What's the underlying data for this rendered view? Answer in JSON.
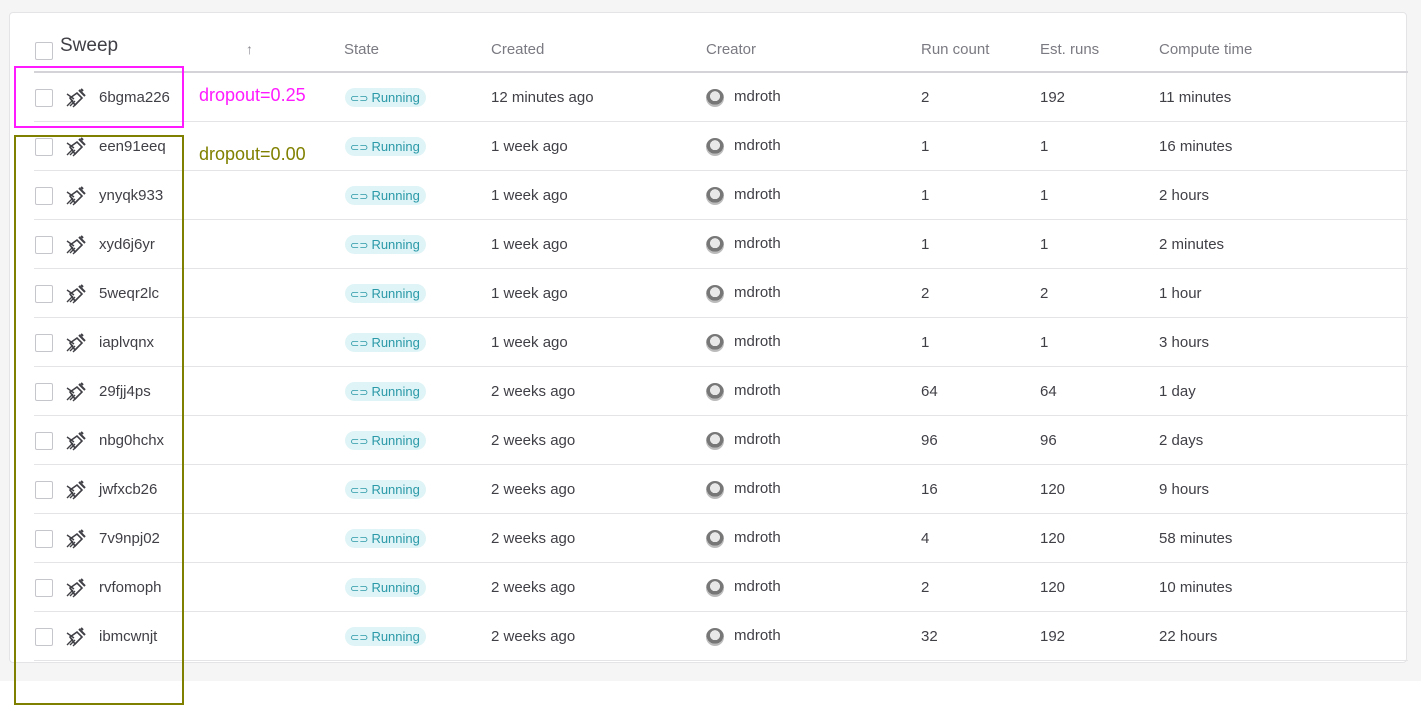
{
  "header": {
    "sweep": "Sweep",
    "state": "State",
    "created": "Created",
    "creator": "Creator",
    "run_count": "Run count",
    "est_runs": "Est. runs",
    "compute_time": "Compute time",
    "sort_icon": "arrow-up"
  },
  "annotations": {
    "magenta_label": "dropout=0.25",
    "olive_label": "dropout=0.00",
    "magenta_color": "#ff1aff",
    "olive_color": "#808000"
  },
  "colors": {
    "badge_bg": "#dff4f6",
    "badge_text": "#2b99a8"
  },
  "rows": [
    {
      "name": "6bgma226",
      "state": "Running",
      "created": "12 minutes ago",
      "creator": "mdroth",
      "run_count": "2",
      "est_runs": "192",
      "compute_time": "11 minutes"
    },
    {
      "name": "een91eeq",
      "state": "Running",
      "created": "1 week ago",
      "creator": "mdroth",
      "run_count": "1",
      "est_runs": "1",
      "compute_time": "16 minutes"
    },
    {
      "name": "ynyqk933",
      "state": "Running",
      "created": "1 week ago",
      "creator": "mdroth",
      "run_count": "1",
      "est_runs": "1",
      "compute_time": "2 hours"
    },
    {
      "name": "xyd6j6yr",
      "state": "Running",
      "created": "1 week ago",
      "creator": "mdroth",
      "run_count": "1",
      "est_runs": "1",
      "compute_time": "2 minutes"
    },
    {
      "name": "5weqr2lc",
      "state": "Running",
      "created": "1 week ago",
      "creator": "mdroth",
      "run_count": "2",
      "est_runs": "2",
      "compute_time": "1 hour"
    },
    {
      "name": "iaplvqnx",
      "state": "Running",
      "created": "1 week ago",
      "creator": "mdroth",
      "run_count": "1",
      "est_runs": "1",
      "compute_time": "3 hours"
    },
    {
      "name": "29fjj4ps",
      "state": "Running",
      "created": "2 weeks ago",
      "creator": "mdroth",
      "run_count": "64",
      "est_runs": "64",
      "compute_time": "1 day"
    },
    {
      "name": "nbg0hchx",
      "state": "Running",
      "created": "2 weeks ago",
      "creator": "mdroth",
      "run_count": "96",
      "est_runs": "96",
      "compute_time": "2 days"
    },
    {
      "name": "jwfxcb26",
      "state": "Running",
      "created": "2 weeks ago",
      "creator": "mdroth",
      "run_count": "16",
      "est_runs": "120",
      "compute_time": "9 hours"
    },
    {
      "name": "7v9npj02",
      "state": "Running",
      "created": "2 weeks ago",
      "creator": "mdroth",
      "run_count": "4",
      "est_runs": "120",
      "compute_time": "58 minutes"
    },
    {
      "name": "rvfomoph",
      "state": "Running",
      "created": "2 weeks ago",
      "creator": "mdroth",
      "run_count": "2",
      "est_runs": "120",
      "compute_time": "10 minutes"
    },
    {
      "name": "ibmcwnjt",
      "state": "Running",
      "created": "2 weeks ago",
      "creator": "mdroth",
      "run_count": "32",
      "est_runs": "192",
      "compute_time": "22 hours"
    }
  ]
}
